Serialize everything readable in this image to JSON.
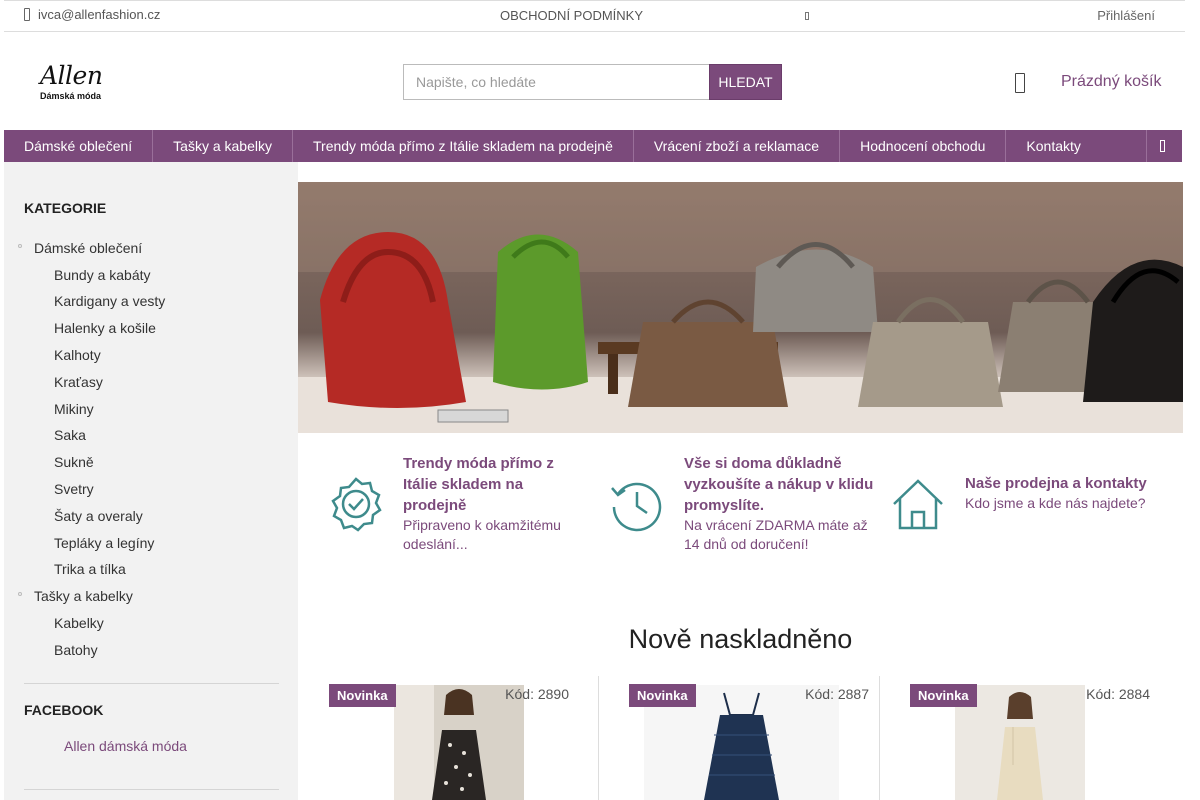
{
  "topbar": {
    "email": "ivca@allenfashion.cz",
    "terms": "OBCHODNÍ PODMÍNKY",
    "login": "Přihlášení"
  },
  "header": {
    "logo_main": "Allen",
    "logo_sub": "Dámská móda",
    "search_placeholder": "Napište, co hledáte",
    "search_button": "HLEDAT",
    "cart_label": "Prázdný košík"
  },
  "nav": {
    "items": [
      "Dámské oblečení",
      "Tašky a kabelky",
      "Trendy móda přímo z Itálie skladem na prodejně",
      "Vrácení zboží a reklamace",
      "Hodnocení obchodu",
      "Kontakty"
    ]
  },
  "sidebar": {
    "categories_title": "KATEGORIE",
    "categories": [
      {
        "label": "Dámské oblečení",
        "level": 1
      },
      {
        "label": "Bundy a kabáty",
        "level": 2
      },
      {
        "label": "Kardigany a vesty",
        "level": 2
      },
      {
        "label": "Halenky a košile",
        "level": 2
      },
      {
        "label": "Kalhoty",
        "level": 2
      },
      {
        "label": "Kraťasy",
        "level": 2
      },
      {
        "label": "Mikiny",
        "level": 2
      },
      {
        "label": "Saka",
        "level": 2
      },
      {
        "label": "Sukně",
        "level": 2
      },
      {
        "label": "Svetry",
        "level": 2
      },
      {
        "label": "Šaty a overaly",
        "level": 2
      },
      {
        "label": "Tepláky a legíny",
        "level": 2
      },
      {
        "label": "Trika a tílka",
        "level": 2
      },
      {
        "label": "Tašky a kabelky",
        "level": 1
      },
      {
        "label": "Kabelky",
        "level": 2
      },
      {
        "label": "Batohy",
        "level": 2
      }
    ],
    "facebook_title": "FACEBOOK",
    "facebook_link": "Allen dámská móda"
  },
  "features": [
    {
      "icon": "badge-check-icon",
      "title": "Trendy móda přímo z Itálie skladem na prodejně",
      "desc": "Připraveno k okamžitému odeslání..."
    },
    {
      "icon": "history-clock-icon",
      "title": "Vše si doma důkladně vyzkoušíte a nákup v klidu promyslíte.",
      "desc": "Na vrácení ZDARMA máte až 14 dnů od doručení!"
    },
    {
      "icon": "home-icon",
      "title": "Naše prodejna a kontakty",
      "desc": "Kdo jsme a kde nás najdete?"
    }
  ],
  "new_section_title": "Nově naskladněno",
  "products": [
    {
      "badge": "Novinka",
      "code": "Kód: 2890"
    },
    {
      "badge": "Novinka",
      "code": "Kód: 2887"
    },
    {
      "badge": "Novinka",
      "code": "Kód: 2884"
    }
  ],
  "colors": {
    "accent": "#7b4a7b",
    "sidebar_bg": "#f2f2f2"
  }
}
